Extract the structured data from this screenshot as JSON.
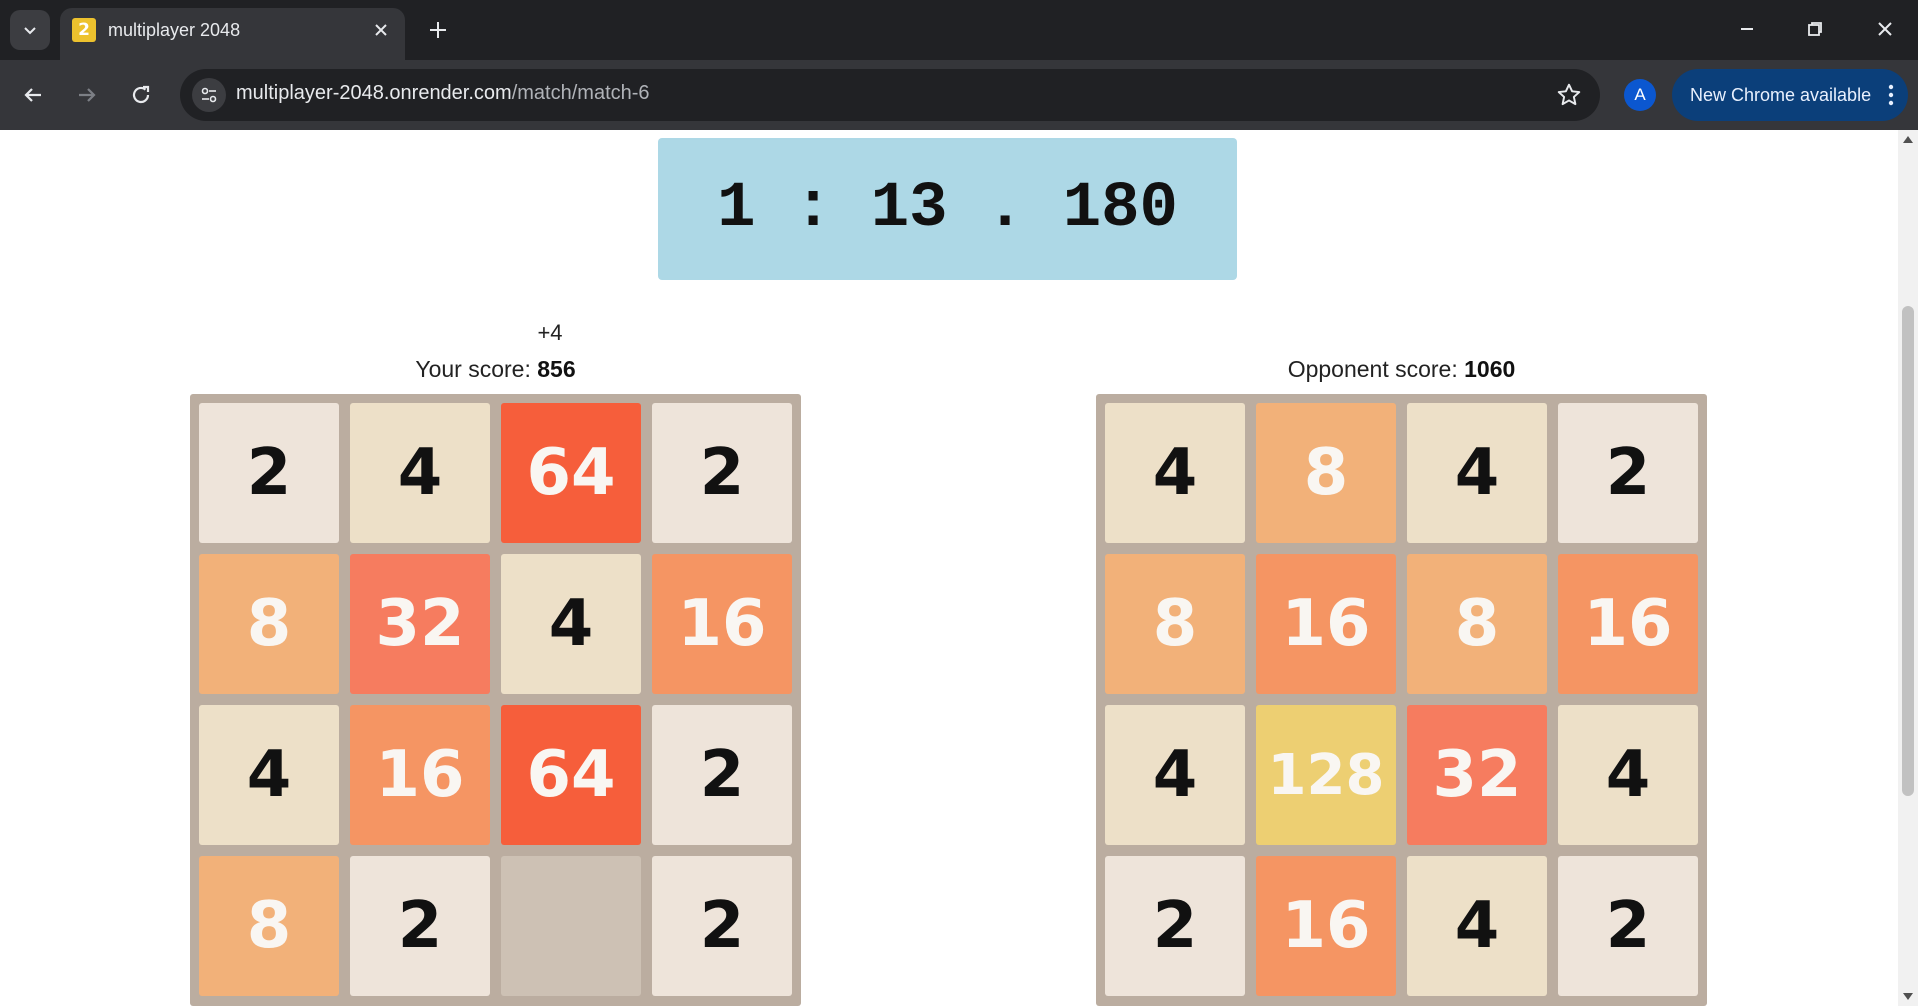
{
  "browser": {
    "tab_title": "multiplayer 2048",
    "favicon_text": "2",
    "url_host": "multiplayer-2048.onrender.com",
    "url_path": "/match/match-6",
    "profile_initial": "A",
    "update_label": "New Chrome available"
  },
  "game": {
    "timer": "1 : 13 . 180",
    "your_delta": "+4",
    "your_score_label": "Your score:",
    "your_score": "856",
    "opponent_score_label": "Opponent score:",
    "opponent_score": "1060",
    "your_board": [
      [
        2,
        4,
        64,
        2
      ],
      [
        8,
        32,
        4,
        16
      ],
      [
        4,
        16,
        64,
        2
      ],
      [
        8,
        2,
        0,
        2
      ]
    ],
    "opponent_board": [
      [
        4,
        8,
        4,
        2
      ],
      [
        8,
        16,
        8,
        16
      ],
      [
        4,
        128,
        32,
        4
      ],
      [
        2,
        16,
        4,
        2
      ]
    ]
  },
  "tile_colors": {
    "0": {
      "bg": "#cdc1b4",
      "fg": "#776e65"
    },
    "2": {
      "bg": "#eee4da",
      "fg": "#111111"
    },
    "4": {
      "bg": "#ede0c8",
      "fg": "#111111"
    },
    "8": {
      "bg": "#f2b179",
      "fg": "#f9f6f2"
    },
    "16": {
      "bg": "#f59563",
      "fg": "#f9f6f2"
    },
    "32": {
      "bg": "#f67c5f",
      "fg": "#f9f6f2"
    },
    "64": {
      "bg": "#f65e3b",
      "fg": "#f9f6f2"
    },
    "128": {
      "bg": "#edcf72",
      "fg": "#f9f6f2"
    }
  }
}
